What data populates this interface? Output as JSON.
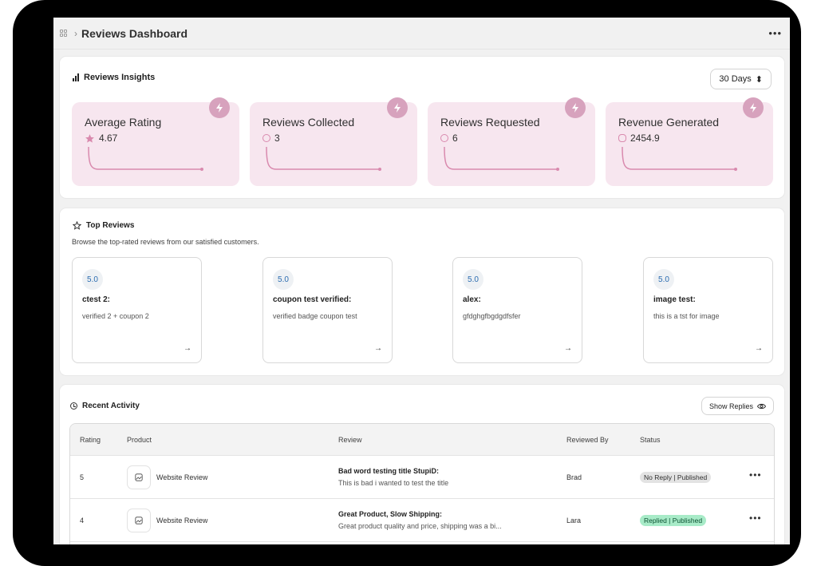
{
  "header": {
    "title": "Reviews Dashboard",
    "breadcrumb_sep": "›",
    "more": "•••"
  },
  "insights": {
    "title": "Reviews Insights",
    "period": "30 Days",
    "period_chevron": "⬍",
    "accent_color": "#f7e6ef",
    "badge_color": "#d7a2bd",
    "cards": [
      {
        "label": "Average Rating",
        "value": "4.67",
        "icon": "star-icon"
      },
      {
        "label": "Reviews Collected",
        "value": "3",
        "icon": "download-circle-icon"
      },
      {
        "label": "Reviews Requested",
        "value": "6",
        "icon": "upload-circle-icon"
      },
      {
        "label": "Revenue Generated",
        "value": "2454.9",
        "icon": "coins-icon"
      }
    ]
  },
  "top_reviews": {
    "title": "Top Reviews",
    "subtitle": "Browse the top-rated reviews from our satisfied customers.",
    "items": [
      {
        "score": "5.0",
        "title": "ctest 2:",
        "body": "verified 2 + coupon 2",
        "arrow": "→"
      },
      {
        "score": "5.0",
        "title": "coupon test verified:",
        "body": "verified badge coupon test",
        "arrow": "→"
      },
      {
        "score": "5.0",
        "title": "alex:",
        "body": "gfdghgfbgdgdfsfer",
        "arrow": "→"
      },
      {
        "score": "5.0",
        "title": "image test:",
        "body": "this is a tst for image",
        "arrow": "→"
      }
    ]
  },
  "recent": {
    "title": "Recent Activity",
    "show_replies": "Show Replies",
    "columns": [
      "Rating",
      "Product",
      "Review",
      "Reviewed By",
      "Status"
    ],
    "rows": [
      {
        "rating": "5",
        "product": "Website Review",
        "review_title": "Bad word testing title StupiD:",
        "review_body": "This is bad i wanted to test the title",
        "reviewer": "Brad",
        "status": "No Reply | Published",
        "status_color": "#e3e3e3",
        "more": "•••"
      },
      {
        "rating": "4",
        "product": "Website Review",
        "review_title": "Great Product, Slow Shipping:",
        "review_body": "Great product quality and price, shipping was a bi...",
        "reviewer": "Lara",
        "status": "Replied | Published",
        "status_color": "#a8ebc8",
        "more": "•••"
      }
    ]
  }
}
